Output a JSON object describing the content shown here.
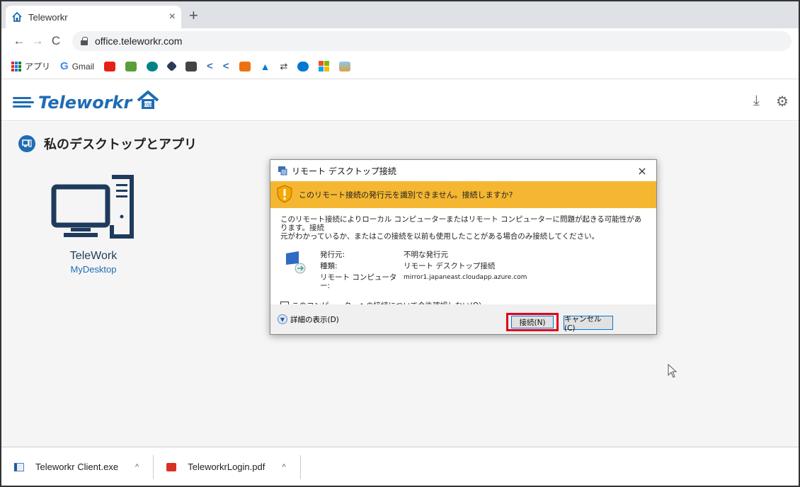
{
  "browser": {
    "tab_title": "Teleworkr",
    "tab_close": "×",
    "new_tab": "+",
    "url": "office.teleworkr.com",
    "back": "←",
    "forward": "→",
    "reload": "C"
  },
  "bookmarks": {
    "apps_label": "アプリ",
    "gmail_label": "Gmail"
  },
  "app": {
    "logo_text": "Teleworkr",
    "download_icon": "⤓",
    "settings_icon": "⚙",
    "section_title": "私のデスクトップとアプリ",
    "desktop_name": "TeleWork",
    "desktop_sub": "MyDesktop"
  },
  "dialog": {
    "title": "リモート デスクトップ接続",
    "close": "×",
    "warning": "このリモート接続の発行元を識別できません。接続しますか?",
    "description_line1": "このリモート接続によりローカル コンピューターまたはリモート コンピューターに問題が起きる可能性があります。接続",
    "description_line2": "元がわかっているか、またはこの接続を以前も使用したことがある場合のみ接続してください。",
    "publisher_label": "発行元:",
    "publisher_value": "不明な発行元",
    "type_label": "種類:",
    "type_value": "リモート デスクトップ接続",
    "computer_label": "リモート コンピューター:",
    "computer_value": "mirror1.japaneast.cloudapp.azure.com",
    "checkbox_label": "このコンピューターへの接続について今後確認しない(O)",
    "details_label": "詳細の表示(D)",
    "connect_button": "接続(N)",
    "cancel_button": "キャンセル(C)"
  },
  "downloads": {
    "items": [
      {
        "name": "Teleworkr Client.exe",
        "chevron": "^"
      },
      {
        "name": "TeleworkrLogin.pdf",
        "chevron": "^"
      }
    ]
  },
  "colors": {
    "brand_blue": "#1f6cb4",
    "warning_bar": "#f5b731",
    "highlight_red": "#e0001a"
  }
}
